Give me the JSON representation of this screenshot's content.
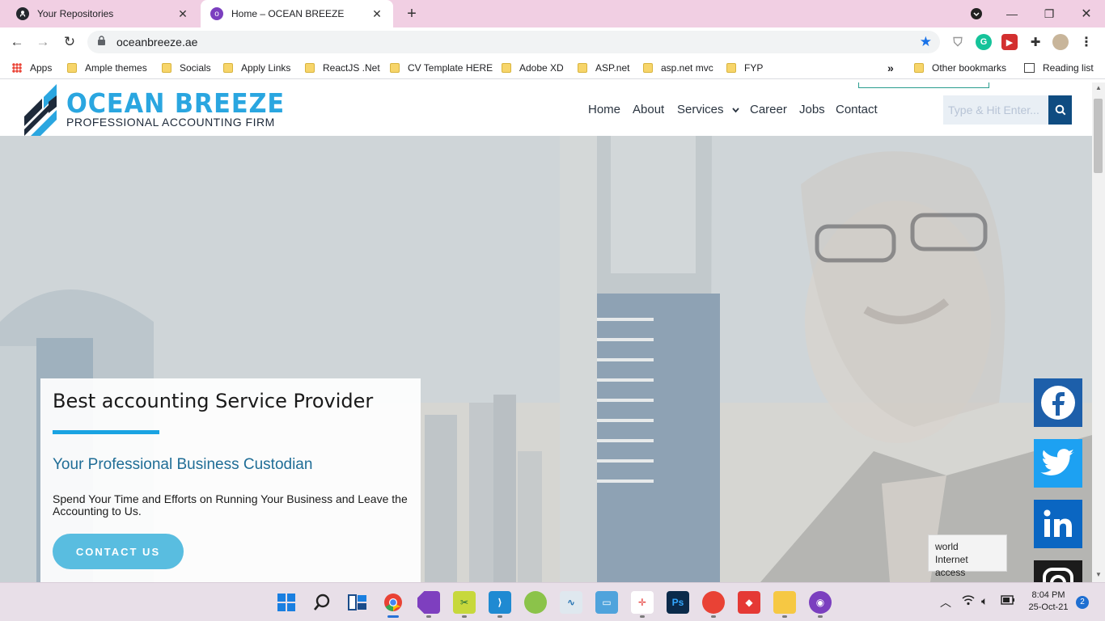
{
  "browser": {
    "tabs": [
      {
        "title": "Your Repositories",
        "icon": "github-icon",
        "active": false
      },
      {
        "title": "Home – OCEAN BREEZE",
        "icon": "site-favicon",
        "active": true
      }
    ],
    "url": "oceanbreeze.ae",
    "bookmarks": [
      {
        "label": "Apps",
        "icon": "apps-grid-icon"
      },
      {
        "label": "Ample themes",
        "icon": "folder-icon"
      },
      {
        "label": "Socials",
        "icon": "folder-icon"
      },
      {
        "label": "Apply Links",
        "icon": "folder-icon"
      },
      {
        "label": "ReactJS .Net",
        "icon": "folder-icon"
      },
      {
        "label": "CV Template HERE",
        "icon": "folder-icon"
      },
      {
        "label": "Adobe XD",
        "icon": "folder-icon"
      },
      {
        "label": "ASP.net",
        "icon": "folder-icon"
      },
      {
        "label": "asp.net mvc",
        "icon": "folder-icon"
      },
      {
        "label": "FYP",
        "icon": "folder-icon"
      }
    ],
    "overflow": "»",
    "other_bookmarks": "Other bookmarks",
    "reading_list": "Reading list"
  },
  "site": {
    "brand": "OCEAN BREEZE",
    "tagline": "PROFESSIONAL ACCOUNTING FIRM",
    "nav": [
      "Home",
      "About",
      "Services",
      "Career",
      "Jobs",
      "Contact"
    ],
    "search_placeholder": "Type & Hit Enter...",
    "hero": {
      "heading": "Best accounting Service Provider",
      "subheading": "Your Professional Business Custodian",
      "text": "Spend Your Time and Efforts on Running Your Business and Leave the Accounting to Us.",
      "cta": "CONTACT US"
    },
    "social": [
      "facebook-icon",
      "twitter-icon",
      "linkedin-icon",
      "instagram-icon"
    ],
    "colors": {
      "brand": "#2aa6e0",
      "dark": "#1e2a3a",
      "accent_bar": "#1aa3e2",
      "cta": "#59bde0",
      "search_btn": "#0f4c81",
      "social": "#1d5faa"
    }
  },
  "tooltip": {
    "line1": "world",
    "line2": "Internet access"
  },
  "taskbar": {
    "time": "8:04 PM",
    "date": "25-Oct-21",
    "notifications": "2"
  }
}
